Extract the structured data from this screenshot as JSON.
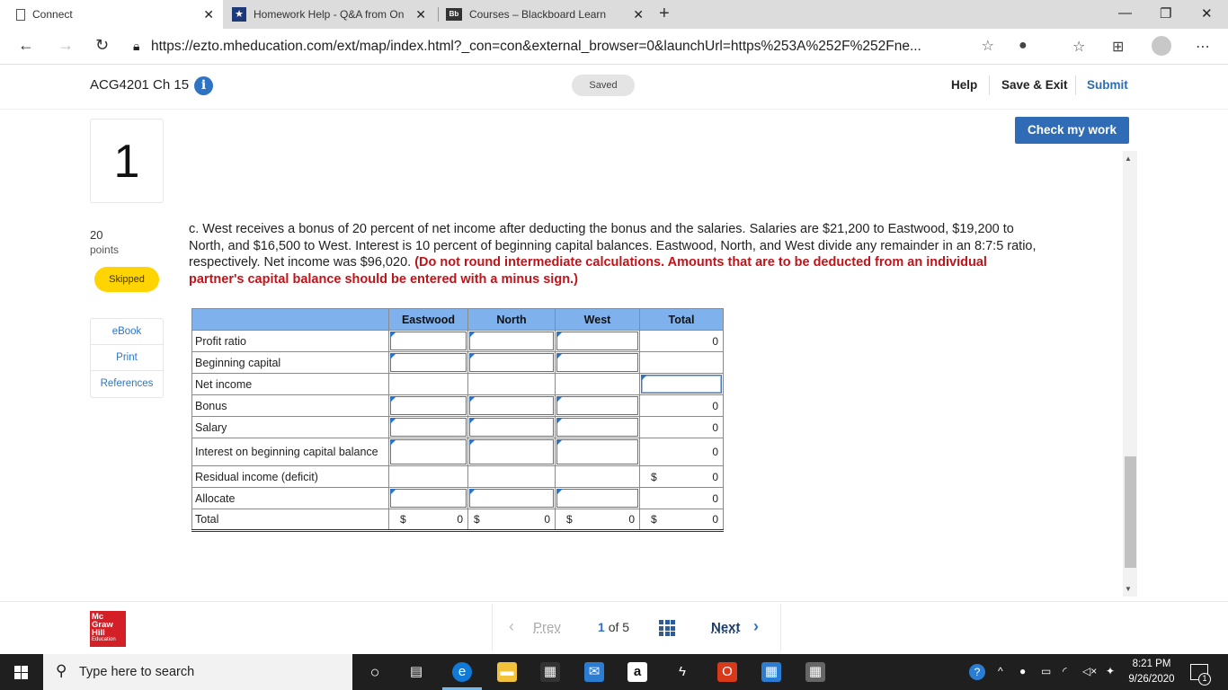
{
  "browser": {
    "tabs": [
      {
        "title": "Connect",
        "active": true
      },
      {
        "title": "Homework Help - Q&A from On",
        "active": false
      },
      {
        "title": "Courses – Blackboard Learn",
        "active": false
      }
    ],
    "url": "https://ezto.mheducation.com/ext/map/index.html?_con=con&external_browser=0&launchUrl=https%253A%252F%252Fne...",
    "blackboard_badge": "Bb"
  },
  "header": {
    "course_title": "ACG4201 Ch 15",
    "info_icon": "i",
    "saved_label": "Saved",
    "help_label": "Help",
    "save_exit_label": "Save & Exit",
    "submit_label": "Submit",
    "check_work_label": "Check my work"
  },
  "question": {
    "number": "1",
    "points": "20",
    "points_label": "points",
    "status": "Skipped",
    "text": "c. West receives a bonus of 20 percent of net income after deducting the bonus and the salaries. Salaries are $21,200 to Eastwood, $19,200 to North, and $16,500 to West. Interest is 10 percent of beginning capital balances. Eastwood, North, and West divide any remainder in an 8:7:5 ratio, respectively. Net income was $96,020.",
    "instruction": "(Do not round intermediate calculations. Amounts that are to be deducted from an individual partner's capital balance should be entered with a minus sign.)"
  },
  "sidebar": {
    "links": [
      "eBook",
      "Print",
      "References"
    ]
  },
  "table": {
    "columns": [
      "Eastwood",
      "North",
      "West",
      "Total"
    ],
    "rows": {
      "profit_ratio": {
        "label": "Profit ratio",
        "total": "0"
      },
      "beginning_capital": {
        "label": "Beginning capital",
        "total": ""
      },
      "net_income": {
        "label": "Net income",
        "total": ""
      },
      "bonus": {
        "label": "Bonus",
        "total": "0"
      },
      "salary": {
        "label": "Salary",
        "total": "0"
      },
      "interest": {
        "label": "Interest on beginning capital balance",
        "total": "0"
      },
      "residual": {
        "label": "Residual income (deficit)",
        "dollar": "$",
        "total": "0"
      },
      "allocate": {
        "label": "Allocate",
        "total": "0"
      },
      "total": {
        "label": "Total",
        "dollar": "$",
        "eastwood": "0",
        "north": "0",
        "west": "0",
        "total": "0"
      }
    }
  },
  "pager": {
    "prev_label": "Prev",
    "current": "1",
    "of_label": "of",
    "count": "5",
    "next_label": "Next"
  },
  "logo": {
    "line1": "Mc",
    "line2": "Graw",
    "line3": "Hill",
    "line4": "Education"
  },
  "taskbar": {
    "search_placeholder": "Type here to search",
    "time": "8:21 PM",
    "date": "9/26/2020",
    "notification_count": "1",
    "amazon_glyph": "a"
  },
  "colors": {
    "accent": "#2f74c4",
    "table_header": "#7fb2ec",
    "skipped": "#ffd400",
    "instruction_red": "#c0141a",
    "logo_red": "#d32027"
  }
}
